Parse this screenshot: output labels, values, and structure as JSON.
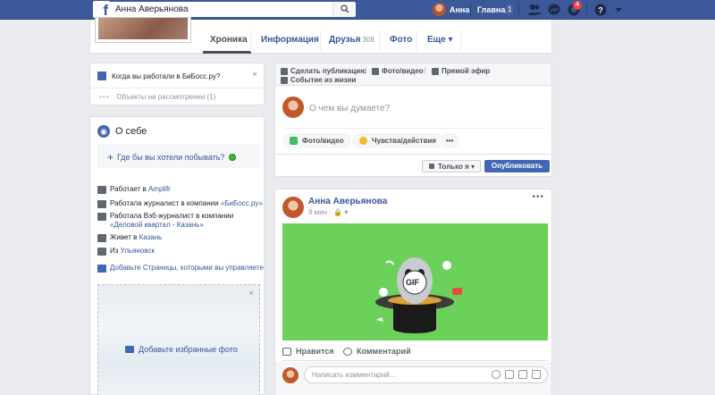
{
  "topbar": {
    "logo": "f",
    "search_value": "Анна Аверьянова",
    "user_name": "Анна",
    "home_label": "Главная",
    "home_count": "1",
    "notifications_count": "4"
  },
  "profile_tabs": {
    "items": [
      {
        "label": "Хроника"
      },
      {
        "label": "Информация"
      },
      {
        "label": "Друзья",
        "count": "308"
      },
      {
        "label": "Фото"
      },
      {
        "label": "Еще ▾"
      }
    ]
  },
  "work_prompt": {
    "question": "Когда вы работали в БиБосс.ру?",
    "close": "×",
    "pending_dots": "•••",
    "pending_label": "Объекты на рассмотрении (1)"
  },
  "about": {
    "title": "О себе",
    "globe_glyph": "◉",
    "question_plus": "+",
    "question": "Где бы вы хотели побывать?",
    "rows": [
      {
        "text": "Работает в ",
        "link": "Amplifr"
      },
      {
        "text": "Работала журналист в компании ",
        "link": "«БиБосс.ру»"
      },
      {
        "text": "Работала Вэб-журналист в компании ",
        "link": "«Деловой квартал - Казань»"
      },
      {
        "text": "Живет в ",
        "link": "Казань"
      },
      {
        "text": "Из ",
        "link": "Ульяновск"
      }
    ],
    "pages_link": "Добавьте Страницы, которыми вы управляете",
    "photos_close": "×",
    "photos_add": "Добавьте избранные фото"
  },
  "composer": {
    "tabs": [
      {
        "label": "Сделать публикацию"
      },
      {
        "label": "Фото/видео"
      },
      {
        "label": "Прямой эфир"
      },
      {
        "label": "Событие из жизни"
      }
    ],
    "placeholder": "О чем вы думаете?",
    "pills": [
      {
        "label": "Фото/видео",
        "color": "#45bd62"
      },
      {
        "label": "Чувства/действия",
        "color": "#f7b928"
      }
    ],
    "more_dots": "•••",
    "privacy_label": "Только я ▾",
    "publish_label": "Опубликовать"
  },
  "post": {
    "author": "Анна Аверьянова",
    "time": "9 мин · 🔒 ▾",
    "more": "•••",
    "gif_label": "GIF",
    "gif_bg": "#6cd15b",
    "like_label": "Нравится",
    "comment_label": "Комментарий",
    "comment_placeholder": "Написать комментарий..."
  },
  "colors": {
    "brand": "#3b5998",
    "button": "#4267b2",
    "link": "#365899"
  }
}
